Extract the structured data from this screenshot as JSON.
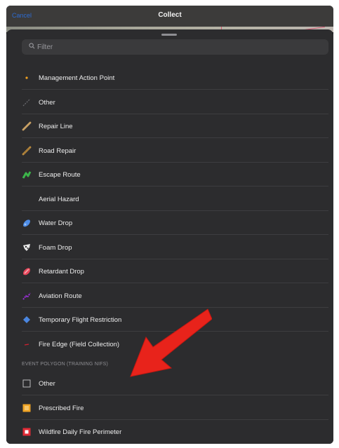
{
  "nav": {
    "cancel_label": "Cancel",
    "title": "Collect"
  },
  "filter": {
    "placeholder": "Filter",
    "value": ""
  },
  "items": [
    {
      "label": "Management Action Point",
      "icon": "orange-dot-icon"
    },
    {
      "label": "Other",
      "icon": "gray-line-icon"
    },
    {
      "label": "Repair Line",
      "icon": "tan-line-icon"
    },
    {
      "label": "Road Repair",
      "icon": "brown-line-icon"
    },
    {
      "label": "Escape Route",
      "icon": "green-route-icon"
    },
    {
      "label": "Aerial Hazard",
      "icon": "none"
    },
    {
      "label": "Water Drop",
      "icon": "blue-drop-icon"
    },
    {
      "label": "Foam Drop",
      "icon": "white-foam-icon"
    },
    {
      "label": "Retardant Drop",
      "icon": "red-retardant-icon"
    },
    {
      "label": "Aviation Route",
      "icon": "purple-route-icon"
    },
    {
      "label": "Temporary Flight Restriction",
      "icon": "blue-diamond-icon"
    },
    {
      "label": "Fire Edge (Field Collection)",
      "icon": "red-line-icon"
    }
  ],
  "section_header": "EVENT POLYGON (TRAINING NIFS)",
  "polygon_items": [
    {
      "label": "Other",
      "icon": "hollow-square-icon"
    },
    {
      "label": "Prescribed Fire",
      "icon": "orange-square-icon"
    },
    {
      "label": "Wildfire Daily Fire Perimeter",
      "icon": "red-square-icon"
    }
  ],
  "colors": {
    "accent": "#2d6bd1",
    "sheet_bg": "#2c2c2e",
    "arrow": "#e8231b"
  }
}
